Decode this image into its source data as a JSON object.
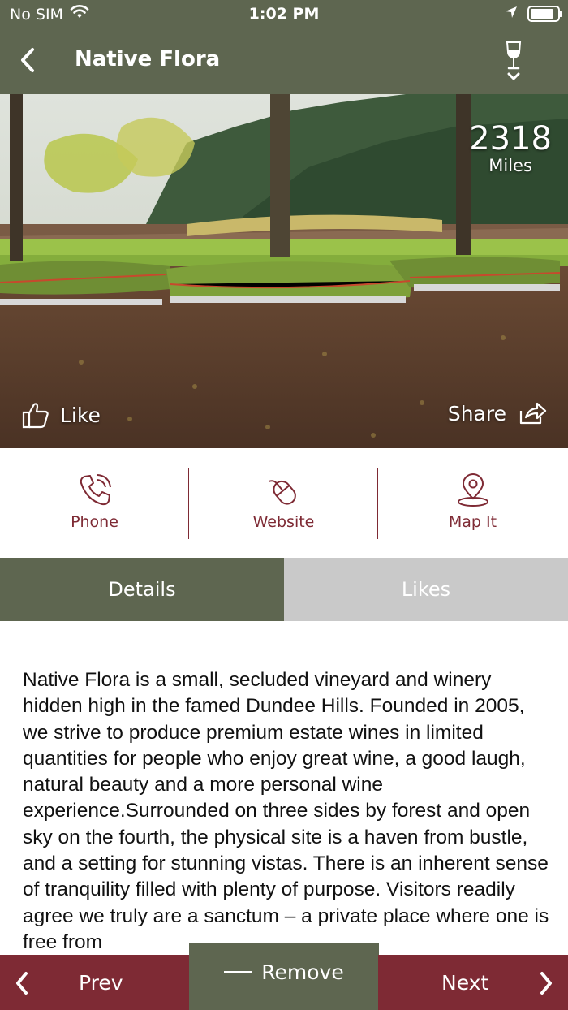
{
  "status_bar": {
    "carrier": "No SIM",
    "time": "1:02 PM",
    "battery_level": 0.9
  },
  "nav": {
    "title": "Native Flora"
  },
  "hero": {
    "distance_value": "2318",
    "distance_unit": "Miles",
    "like_label": "Like",
    "share_label": "Share"
  },
  "actions": [
    {
      "label": "Phone",
      "icon": "phone-icon"
    },
    {
      "label": "Website",
      "icon": "mouse-icon"
    },
    {
      "label": "Map It",
      "icon": "map-pin-icon"
    }
  ],
  "tabs": [
    {
      "label": "Details",
      "active": true
    },
    {
      "label": "Likes",
      "active": false
    }
  ],
  "details_text": "Native Flora is a small, secluded vineyard and winery hidden high in the famed Dundee Hills. Founded in 2005, we strive to produce premium estate wines in limited quantities for people who enjoy great wine, a good laugh, natural beauty and a more personal wine experience.Surrounded on three sides by forest and open sky on the fourth, the physical site is a haven from bustle, and a setting for stunning vistas. There is an inherent sense of tranquility filled with plenty of purpose. Visitors readily agree we truly are a sanctum – a private place where one is free from",
  "bottom_bar": {
    "prev_label": "Prev",
    "remove_label": "Remove",
    "next_label": "Next"
  },
  "colors": {
    "olive": "#5e6650",
    "burgundy": "#7e2a34",
    "inactive_tab": "#c9c9c9"
  }
}
